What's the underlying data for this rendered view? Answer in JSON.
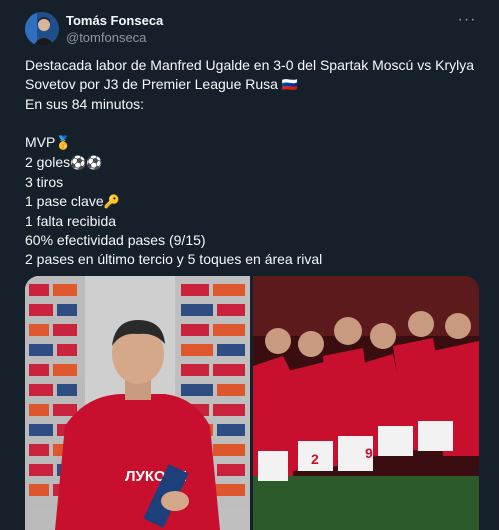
{
  "author": {
    "display_name": "Tomás Fonseca",
    "handle": "@tomfonseca",
    "avatar_icon": "user-avatar"
  },
  "more_icon": "more-options-icon",
  "tweet": {
    "line1": "Destacada labor de Manfred Ugalde en 3-0 del Spartak Moscú vs Krylya Sovetov por J3 de Premier League Rusa ",
    "flag": "🇷🇺",
    "line2": "En sus 84 minutos:",
    "mvp": "MVP",
    "mvp_emoji": "🥇",
    "goals": "2 goles",
    "goals_emoji": "⚽⚽",
    "shots": "3 tiros",
    "key_pass": "1 pase clave",
    "key_pass_emoji": "🔑",
    "fouls": "1 falta recibida",
    "pass_acc": "60% efectividad pases (9/15)",
    "final_third": "2 pases en último tercio y 5 toques en área rival"
  },
  "media": {
    "left_board_text": "ЛУКОЙЛ",
    "right_shirt_numbers": [
      "2",
      "9"
    ]
  },
  "colors": {
    "background": "#15202b",
    "text": "#f7f9f9",
    "muted": "#8b98a5",
    "spartak_red": "#c8102e"
  }
}
